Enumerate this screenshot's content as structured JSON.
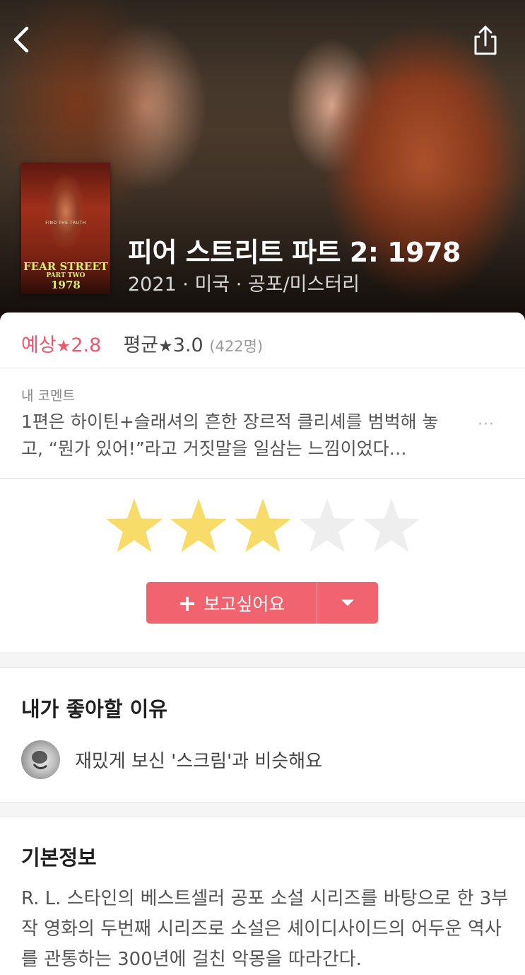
{
  "header": {
    "back_icon": "chevron-left-icon",
    "share_icon": "share-icon"
  },
  "movie": {
    "title": "피어 스트리트 파트 2: 1978",
    "meta": "2021 · 미국 · 공포/미스터리",
    "poster": {
      "tagline": "FIND THE TRUTH",
      "title_line1": "FEAR STREET",
      "title_line2": "PART TWO",
      "title_line3": "1978"
    }
  },
  "rating": {
    "expected_label": "예상",
    "expected_value": "2.8",
    "average_label": "평균",
    "average_value": "3.0",
    "count": "(422명)",
    "star_glyph": "★"
  },
  "my_comment": {
    "label": "내 코멘트",
    "text": "1편은 하이틴+슬래셔의 흔한 장르적 클리셰를 범벅해 놓고, “뭔가 있어!”라고 거짓말을 일삼는 느낌이었다…",
    "more": "···"
  },
  "user_rating": {
    "max": 5,
    "value": 3,
    "filled_color": "#f8dc6a",
    "empty_color": "#eeeeee"
  },
  "wishlist_button": {
    "plus": "+",
    "label": "보고싶어요"
  },
  "reasons": {
    "title": "내가 좋아할 이유",
    "item": "재밌게 보신 '스크림'과 비슷해요"
  },
  "basic_info": {
    "title": "기본정보",
    "description": "R. L. 스타인의 베스트셀러 공포 소설 시리즈를 바탕으로 한 3부작 영화의 두번째 시리즈로 소설은 셰이디사이드의 어두운 역사를 관통하는 300년에 걸친 악몽을 따라간다."
  },
  "colors": {
    "accent": "#f0636f",
    "expected": "#f1566b"
  }
}
